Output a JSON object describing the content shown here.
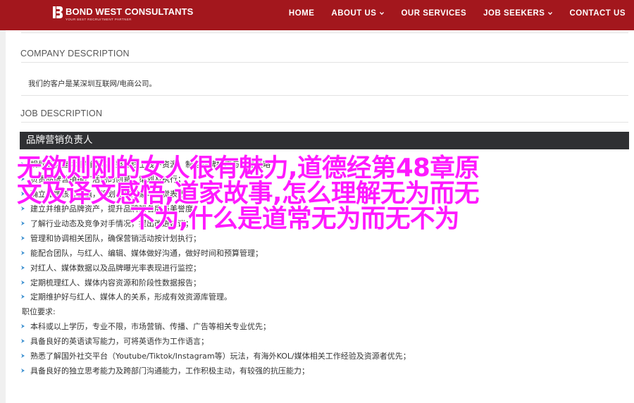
{
  "header": {
    "brand_name": "BOND WEST CONSULTANTS",
    "brand_tagline": "YOUR BEST RECRUITMENT PARTNER",
    "nav": [
      {
        "label": "HOME",
        "dropdown": false
      },
      {
        "label": "ABOUT US",
        "dropdown": true
      },
      {
        "label": "OUR SERVICES",
        "dropdown": false
      },
      {
        "label": "JOB SEEKERS",
        "dropdown": true
      },
      {
        "label": "CONTACT US",
        "dropdown": false
      }
    ],
    "bg_color": "#a3171d"
  },
  "company": {
    "title": "COMPANY DESCRIPTION",
    "text": "我们的客户是某深圳互联网/电商公司。"
  },
  "job": {
    "title": "JOB DESCRIPTION",
    "role": "品牌营销负责人",
    "duties": [
      "规划品牌整体营销策略，整合线上线下资源，制定品牌推广与传播策略；",
      "负责品牌营销推广活动的创意、策划及执行；",
      "确立品牌核心价值，规划品牌形象与视觉表达；",
      "建立并维护品牌资产，提升品牌知名度与美誉度；",
      "了解行业动态及竞争对手情况，提出改进建议；",
      "管理和协调相关团队，确保营销活动按计划执行；",
      "能配合团队，与红人、编辑、媒体做好沟通，做好时间和预算管理；",
      "对红人、媒体数据以及品牌曝光率表现进行监控；",
      "定期梳理红人、媒体内容资源和阶段性数据报告；",
      "定期维护好与红人、媒体人的关系，形成有效资源库管理。"
    ],
    "requirements_title": "职位要求:",
    "requirements": [
      "本科或以上学历，专业不限，市场营销、传播、广告等相关专业优先；",
      "具备良好的英语读写能力，可将英语作为工作语言；",
      "熟悉了解国外社交平台（Youtube/Tiktok/Instagram等）玩法，有海外KOL/媒体相关工作经验及资源者优先；",
      "具备良好的独立思考能力及跨部门沟通能力，工作积极主动，有较强的抗压能力；"
    ]
  },
  "overlay": {
    "line1": "无欲则刚的女人很有魅力,道德经第48章原",
    "line2": "文及译文感悟,道家故事,怎么理解无为而无",
    "line3": "不为,什么是道常无为而无不为",
    "color": "#ff19ff"
  }
}
